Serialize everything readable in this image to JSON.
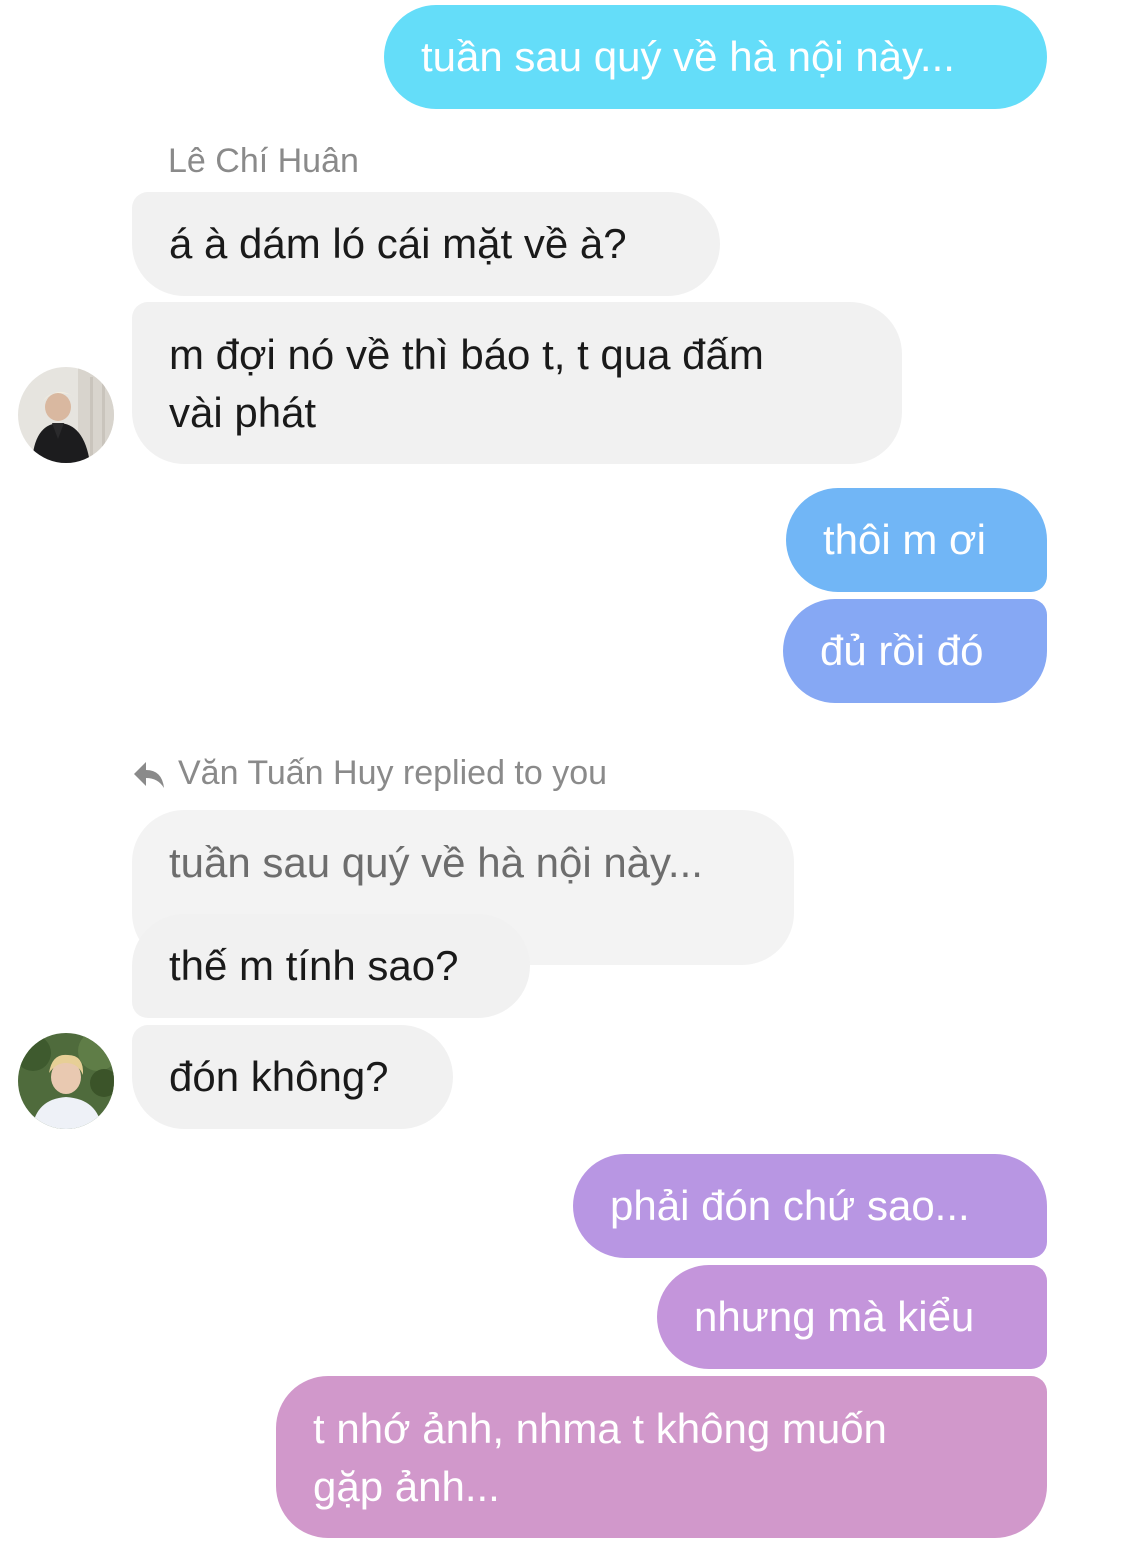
{
  "messages": {
    "m1": "tuần sau quý về hà nội này...",
    "m2_sender": "Lê Chí Huân",
    "m2": "á à dám ló cái mặt về à?",
    "m3_line1": "m đợi nó về thì báo t, t qua đấm",
    "m3_line2": "vài phát",
    "m4": "thôi m ơi",
    "m5": "đủ rồi đó",
    "reply_header": "Văn Tuấn Huy replied to you",
    "quoted": "tuần sau quý về hà nội này...",
    "m6": "thế m tính sao?",
    "m7": "đón không?",
    "m8": "phải đón chứ sao...",
    "m9": "nhưng mà kiểu",
    "m10_line1": "t nhớ ảnh, nhma t không muốn",
    "m10_line2": "gặp ảnh..."
  },
  "icons": {
    "reply": "reply-arrow-icon"
  },
  "colors": {
    "incoming_bubble": "#f1f1f1",
    "outgoing_cyan": "#62dcf8",
    "outgoing_blue": "#72b6f6",
    "outgoing_purple": "#bf95dc",
    "outgoing_pink": "#d597cb"
  }
}
